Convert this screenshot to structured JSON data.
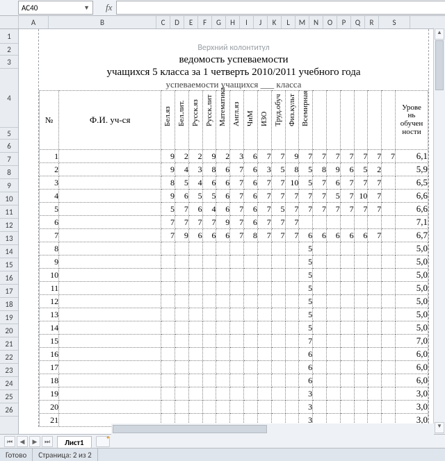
{
  "cellRef": "AC40",
  "fxLabel": "fx",
  "formula": "",
  "cols": [
    "A",
    "B",
    "C",
    "D",
    "E",
    "F",
    "G",
    "H",
    "I",
    "J",
    "K",
    "L",
    "M",
    "N",
    "O",
    "P",
    "Q",
    "R",
    "S"
  ],
  "rowNums": [
    "1",
    "2",
    "3",
    "4",
    "5",
    "6",
    "7",
    "8",
    "9",
    "10",
    "11",
    "12",
    "13",
    "14",
    "15",
    "16",
    "17",
    "18",
    "19",
    "20",
    "21",
    "22",
    "23",
    "24",
    "25",
    "26"
  ],
  "runningHeader": "Верхний колонтитул",
  "title1": "ведомость успеваемости",
  "title2": "учащихся 5 класса за 1 четверть  2010/2011 учебного года",
  "title3": "успеваемости учащихся ___ класса",
  "headers": {
    "num": "№",
    "fio": "Ф.И. уч-ся",
    "subjects": [
      "Бел.яз",
      "Бел.лит.",
      "Русск.яз",
      "Русск.лит",
      "Математика",
      "Англ.яз",
      "ЧиМ",
      "ИЗО",
      "Труд.обуч",
      "Физ.культ",
      "Всемирная",
      "",
      "",
      "",
      "",
      "",
      ""
    ],
    "level": "Урове нь обучен ности"
  },
  "rows": [
    {
      "n": "1",
      "v": [
        "9",
        "2",
        "2",
        "9",
        "2",
        "3",
        "6",
        "7",
        "7",
        "9",
        "7",
        "7",
        "7",
        "7",
        "7",
        "7",
        "7"
      ],
      "lvl": "6,1"
    },
    {
      "n": "2",
      "v": [
        "9",
        "4",
        "3",
        "8",
        "6",
        "7",
        "6",
        "3",
        "5",
        "8",
        "5",
        "8",
        "9",
        "6",
        "5",
        "2",
        ""
      ],
      "lvl": "5,9"
    },
    {
      "n": "3",
      "v": [
        "8",
        "5",
        "4",
        "6",
        "6",
        "7",
        "6",
        "7",
        "7",
        "10",
        "5",
        "7",
        "6",
        "7",
        "7",
        "7",
        ""
      ],
      "lvl": "6,5"
    },
    {
      "n": "4",
      "v": [
        "9",
        "6",
        "5",
        "5",
        "6",
        "7",
        "6",
        "7",
        "7",
        "7",
        "7",
        "7",
        "5",
        "7",
        "10",
        "7",
        ""
      ],
      "lvl": "6,6"
    },
    {
      "n": "5",
      "v": [
        "5",
        "7",
        "6",
        "4",
        "6",
        "7",
        "6",
        "7",
        "5",
        "7",
        "7",
        "7",
        "7",
        "7",
        "7",
        "7",
        ""
      ],
      "lvl": "6,6"
    },
    {
      "n": "6",
      "v": [
        "7",
        "7",
        "7",
        "7",
        "9",
        "7",
        "6",
        "7",
        "7",
        "7",
        "",
        "",
        "",
        "",
        "",
        "",
        ""
      ],
      "lvl": "7,1"
    },
    {
      "n": "7",
      "v": [
        "7",
        "9",
        "6",
        "6",
        "6",
        "7",
        "8",
        "7",
        "7",
        "7",
        "6",
        "6",
        "6",
        "6",
        "6",
        "7",
        ""
      ],
      "lvl": "6,7"
    },
    {
      "n": "8",
      "v": [
        "",
        "",
        "",
        "",
        "",
        "",
        "",
        "",
        "",
        "",
        "5",
        "",
        "",
        "",
        "",
        "",
        ""
      ],
      "lvl": "5,0"
    },
    {
      "n": "9",
      "v": [
        "",
        "",
        "",
        "",
        "",
        "",
        "",
        "",
        "",
        "",
        "5",
        "",
        "",
        "",
        "",
        "",
        ""
      ],
      "lvl": "5,0"
    },
    {
      "n": "10",
      "v": [
        "",
        "",
        "",
        "",
        "",
        "",
        "",
        "",
        "",
        "",
        "5",
        "",
        "",
        "",
        "",
        "",
        ""
      ],
      "lvl": "5,0"
    },
    {
      "n": "11",
      "v": [
        "",
        "",
        "",
        "",
        "",
        "",
        "",
        "",
        "",
        "",
        "5",
        "",
        "",
        "",
        "",
        "",
        ""
      ],
      "lvl": "5,0"
    },
    {
      "n": "12",
      "v": [
        "",
        "",
        "",
        "",
        "",
        "",
        "",
        "",
        "",
        "",
        "5",
        "",
        "",
        "",
        "",
        "",
        ""
      ],
      "lvl": "5,0"
    },
    {
      "n": "13",
      "v": [
        "",
        "",
        "",
        "",
        "",
        "",
        "",
        "",
        "",
        "",
        "5",
        "",
        "",
        "",
        "",
        "",
        ""
      ],
      "lvl": "5,0"
    },
    {
      "n": "14",
      "v": [
        "",
        "",
        "",
        "",
        "",
        "",
        "",
        "",
        "",
        "",
        "5",
        "",
        "",
        "",
        "",
        "",
        ""
      ],
      "lvl": "5,0"
    },
    {
      "n": "15",
      "v": [
        "",
        "",
        "",
        "",
        "",
        "",
        "",
        "",
        "",
        "",
        "7",
        "",
        "",
        "",
        "",
        "",
        ""
      ],
      "lvl": "7,0"
    },
    {
      "n": "16",
      "v": [
        "",
        "",
        "",
        "",
        "",
        "",
        "",
        "",
        "",
        "",
        "6",
        "",
        "",
        "",
        "",
        "",
        ""
      ],
      "lvl": "6,0"
    },
    {
      "n": "17",
      "v": [
        "",
        "",
        "",
        "",
        "",
        "",
        "",
        "",
        "",
        "",
        "6",
        "",
        "",
        "",
        "",
        "",
        ""
      ],
      "lvl": "6,0"
    },
    {
      "n": "18",
      "v": [
        "",
        "",
        "",
        "",
        "",
        "",
        "",
        "",
        "",
        "",
        "6",
        "",
        "",
        "",
        "",
        "",
        ""
      ],
      "lvl": "6,0"
    },
    {
      "n": "19",
      "v": [
        "",
        "",
        "",
        "",
        "",
        "",
        "",
        "",
        "",
        "",
        "3",
        "",
        "",
        "",
        "",
        "",
        ""
      ],
      "lvl": "3,0"
    },
    {
      "n": "20",
      "v": [
        "",
        "",
        "",
        "",
        "",
        "",
        "",
        "",
        "",
        "",
        "3",
        "",
        "",
        "",
        "",
        "",
        ""
      ],
      "lvl": "3,0"
    },
    {
      "n": "21",
      "v": [
        "",
        "",
        "",
        "",
        "",
        "",
        "",
        "",
        "",
        "",
        "3",
        "",
        "",
        "",
        "",
        "",
        ""
      ],
      "lvl": "3,0"
    }
  ],
  "tab": "Лист1",
  "statusReady": "Готово",
  "statusPage": "Страница: 2 из 2"
}
